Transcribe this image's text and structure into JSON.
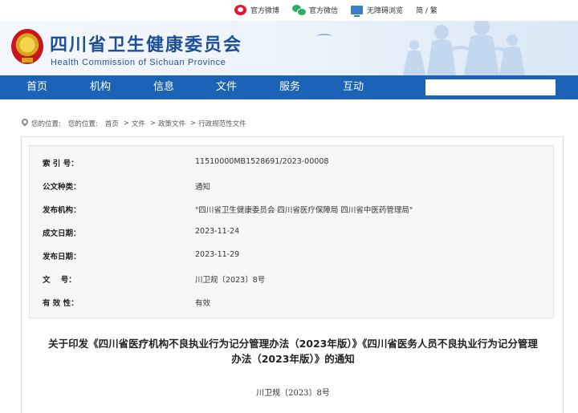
{
  "topbar": {
    "links": [
      {
        "label": "官方微博",
        "icon": "weibo-icon"
      },
      {
        "label": "官方微信",
        "icon": "wechat-icon"
      },
      {
        "label": "无障碍浏览",
        "icon": "accessibility-icon"
      }
    ],
    "lang_label": "简 / 繁"
  },
  "header": {
    "title": "四川省卫生健康委员会",
    "subtitle": "Health Commission of Sichuan Province"
  },
  "nav": {
    "items": [
      "首页",
      "机构",
      "信息",
      "文件",
      "服务",
      "互动"
    ],
    "search_placeholder": ""
  },
  "breadcrumb": {
    "prefix": "您的位置:",
    "items": [
      "首页",
      "文件",
      "政策文件",
      "行政规范性文件"
    ],
    "separator": ">"
  },
  "meta": [
    {
      "label": "索 引 号：",
      "value": "11510000MB1528691/2023-00008"
    },
    {
      "label": "公文种类：",
      "value": "通知"
    },
    {
      "label": "发布机构：",
      "value": "\"四川省卫生健康委员会 四川省医疗保障局 四川省中医药管理局\""
    },
    {
      "label": "成文日期：",
      "value": "2023-11-24"
    },
    {
      "label": "发布日期：",
      "value": "2023-11-29"
    },
    {
      "label": "文    号：",
      "value": "川卫规〔2023〕8号"
    },
    {
      "label": "有 效 性：",
      "value": "有效"
    }
  ],
  "document": {
    "title_line1": "关于印发《四川省医疗机构不良执业行为记分管理办法（2023年版）》《四川省医务人员不良执业行为记分管理",
    "title_line2": "办法（2023年版）》的通知",
    "number": "川卫规〔2023〕8号"
  },
  "colors": {
    "nav_bg": "#1b63b6",
    "brand_blue": "#1e4f9a",
    "meta_bg": "#f7f7f7"
  }
}
